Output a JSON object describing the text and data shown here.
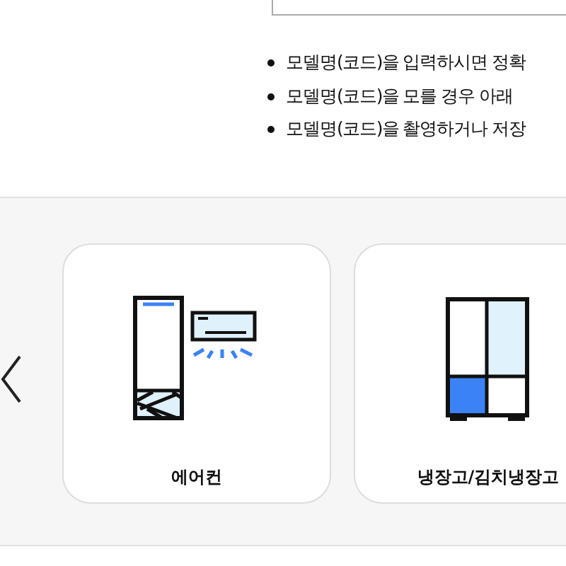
{
  "notes": [
    "모델명(코드)을 입력하시면 정확",
    "모델명(코드)을 모를 경우 아래",
    "모델명(코드)을 촬영하거나 저장"
  ],
  "categories": [
    {
      "label": "에어컨",
      "kind": "aircon"
    },
    {
      "label": "냉장고/김치냉장고",
      "kind": "fridge"
    }
  ]
}
